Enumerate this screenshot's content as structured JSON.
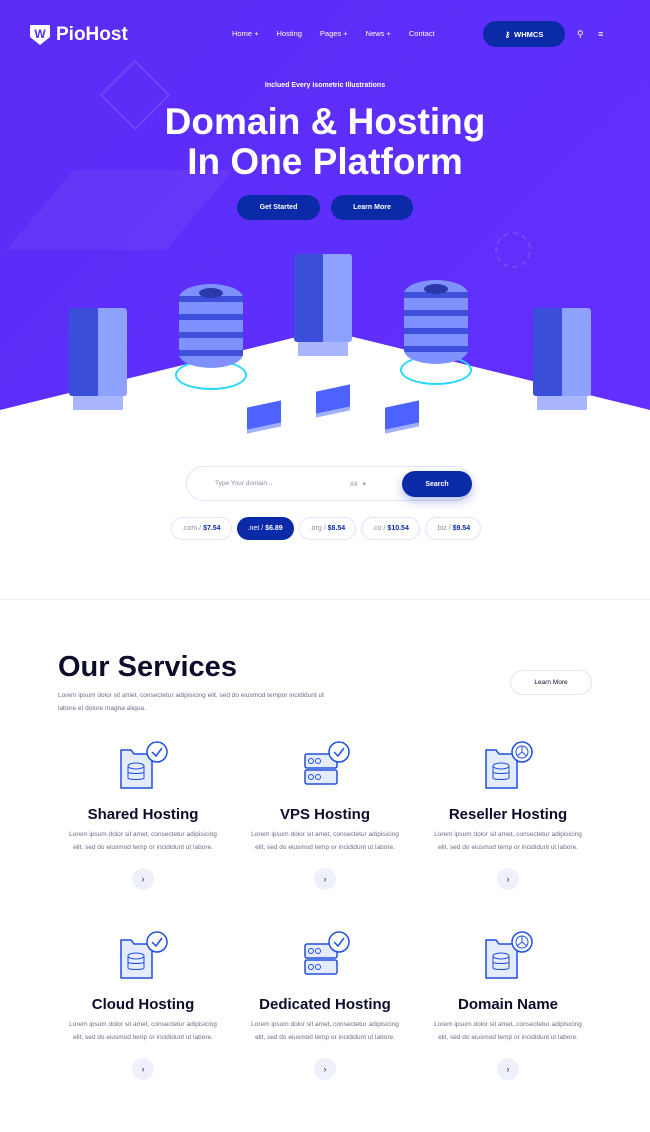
{
  "brand": {
    "name": "PioHost",
    "accent": "#5a2cf5",
    "dark_blue": "#0a2aa8"
  },
  "nav": {
    "items": [
      "Home +",
      "Hosting",
      "Pages +",
      "News +",
      "Contact"
    ],
    "whmcs": "WHMCS",
    "icons": [
      "key-icon",
      "search-icon",
      "menu-icon"
    ]
  },
  "hero": {
    "tagline": "Inclued Every Isometric Illustrations",
    "title_line1": "Domain & Hosting",
    "title_line2": "In One Platform",
    "get_started": "Get Started",
    "learn_more": "Learn More"
  },
  "search": {
    "placeholder": "Type Your domain...",
    "select": "All",
    "button": "Search"
  },
  "tlds": [
    {
      "ext": ".com /",
      "price": "$7.54"
    },
    {
      "ext": ".net /",
      "price": "$6.89",
      "active": true
    },
    {
      "ext": ".org /",
      "price": "$8.54"
    },
    {
      "ext": ".co /",
      "price": "$10.54"
    },
    {
      "ext": ".biz /",
      "price": "$9.54"
    }
  ],
  "services": {
    "title": "Our Services",
    "desc": "Lorem ipsum dolor sit amet, consectetur adipisicing elit, sed do eiusmod tempor incididunt ut labore et dolore magna aliqua.",
    "learn_more": "Learn More",
    "items": [
      {
        "title": "Shared Hosting",
        "text": "Lorem ipsum dolor sit amet, consectetur adipisicing elit, sed do eiusmod temp or incididunt ut labore.",
        "icon": "folder-database-check-icon"
      },
      {
        "title": "VPS Hosting",
        "text": "Lorem ipsum dolor sit amet, consectetur adipisicing elit, sed do eiusmod temp or incididunt ut labore.",
        "icon": "server-check-icon"
      },
      {
        "title": "Reseller Hosting",
        "text": "Lorem ipsum dolor sit amet, consectetur adipisicing elit, sed do eiusmod temp or incididunt ut labore.",
        "icon": "folder-database-chart-icon"
      },
      {
        "title": "Cloud Hosting",
        "text": "Lorem ipsum dolor sit amet, consectetur adipisicing elit, sed do eiusmod temp or incididunt ut labore.",
        "icon": "folder-database-check-icon"
      },
      {
        "title": "Dedicated Hosting",
        "text": "Lorem ipsum dolor sit amet, consectetur adipisicing elit, sed do eiusmod temp or incididunt ut labore.",
        "icon": "server-check-icon"
      },
      {
        "title": "Domain Name",
        "text": "Lorem ipsum dolor sit amet, consectetur adipisicing elit, sed do eiusmod temp or incididunt ut labore.",
        "icon": "folder-database-chart-icon"
      }
    ],
    "arrow": "›"
  }
}
